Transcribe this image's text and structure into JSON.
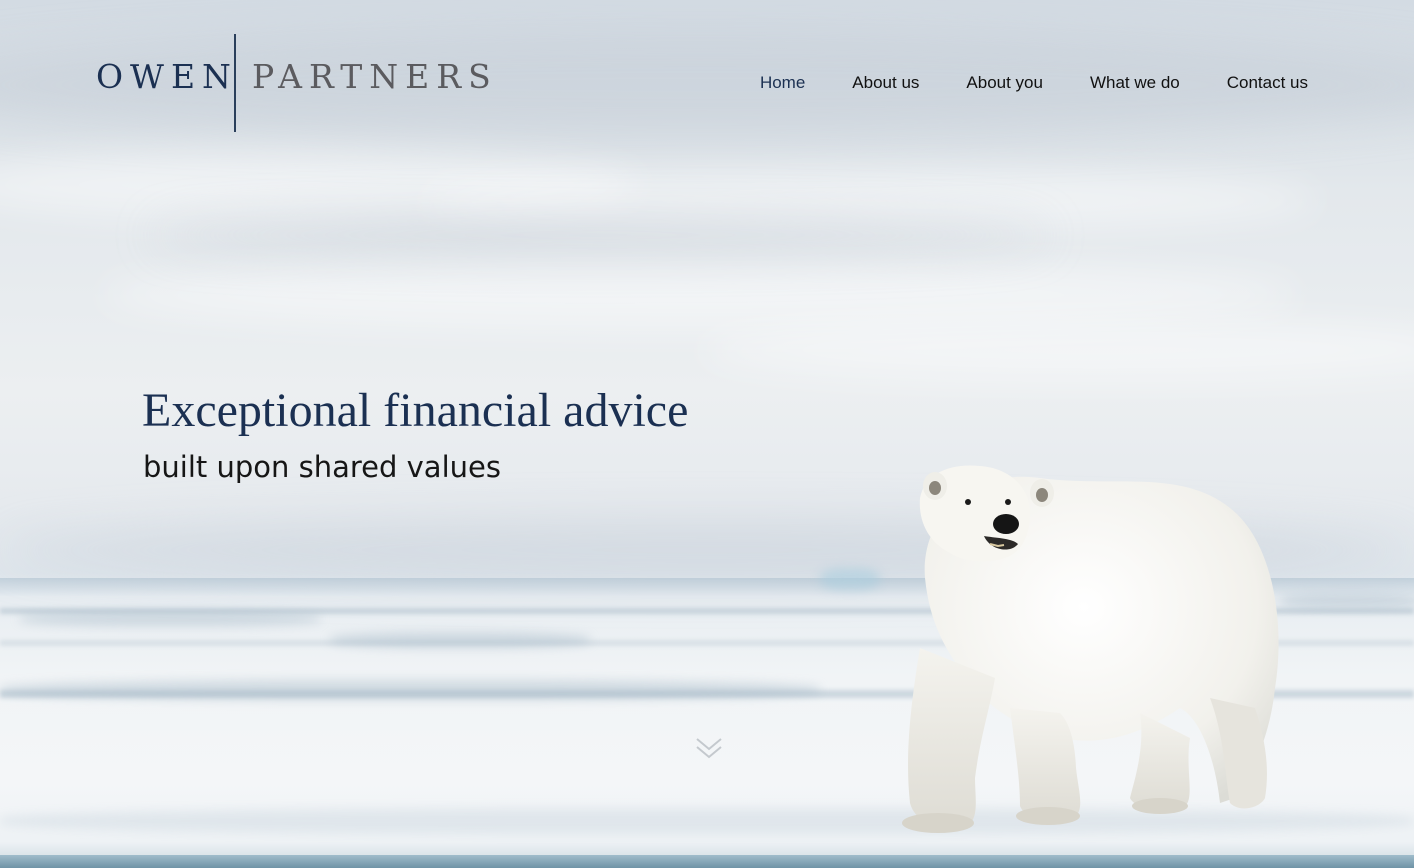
{
  "brand": {
    "name_primary": "OWEN",
    "name_secondary": "PARTNERS",
    "primary_color": "#1b3052",
    "secondary_color": "#5b5b5f"
  },
  "nav": {
    "items": [
      {
        "label": "Home",
        "active": true
      },
      {
        "label": "About us",
        "active": false
      },
      {
        "label": "About you",
        "active": false
      },
      {
        "label": "What we do",
        "active": false
      },
      {
        "label": "Contact us",
        "active": false
      }
    ]
  },
  "hero": {
    "headline": "Exceptional financial advice",
    "subheadline": "built upon shared values",
    "scroll_icon": "double-chevron-down-icon",
    "image_subject": "polar-bear-on-sea-ice"
  }
}
